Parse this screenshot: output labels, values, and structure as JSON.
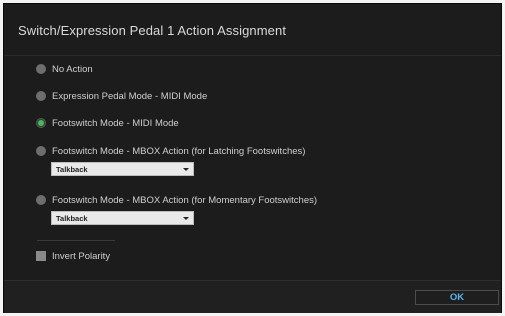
{
  "dialog": {
    "title": "Switch/Expression Pedal 1 Action Assignment"
  },
  "options": [
    {
      "label": "No Action",
      "selected": false
    },
    {
      "label": "Expression Pedal Mode - MIDI Mode",
      "selected": false
    },
    {
      "label": "Footswitch Mode - MIDI Mode",
      "selected": true
    },
    {
      "label": "Footswitch Mode - MBOX Action (for Latching Footswitches)",
      "selected": false
    },
    {
      "label": "Footswitch Mode - MBOX Action (for Momentary Footswitches)",
      "selected": false
    }
  ],
  "latching_select": {
    "value": "Talkback"
  },
  "momentary_select": {
    "value": "Talkback"
  },
  "invert_polarity": {
    "label": "Invert Polarity",
    "checked": false
  },
  "footer": {
    "ok_label": "OK"
  },
  "colors": {
    "selected_dot": "#3cc44a",
    "ok_text": "#5ab4f0",
    "background": "#1c1c1c"
  }
}
